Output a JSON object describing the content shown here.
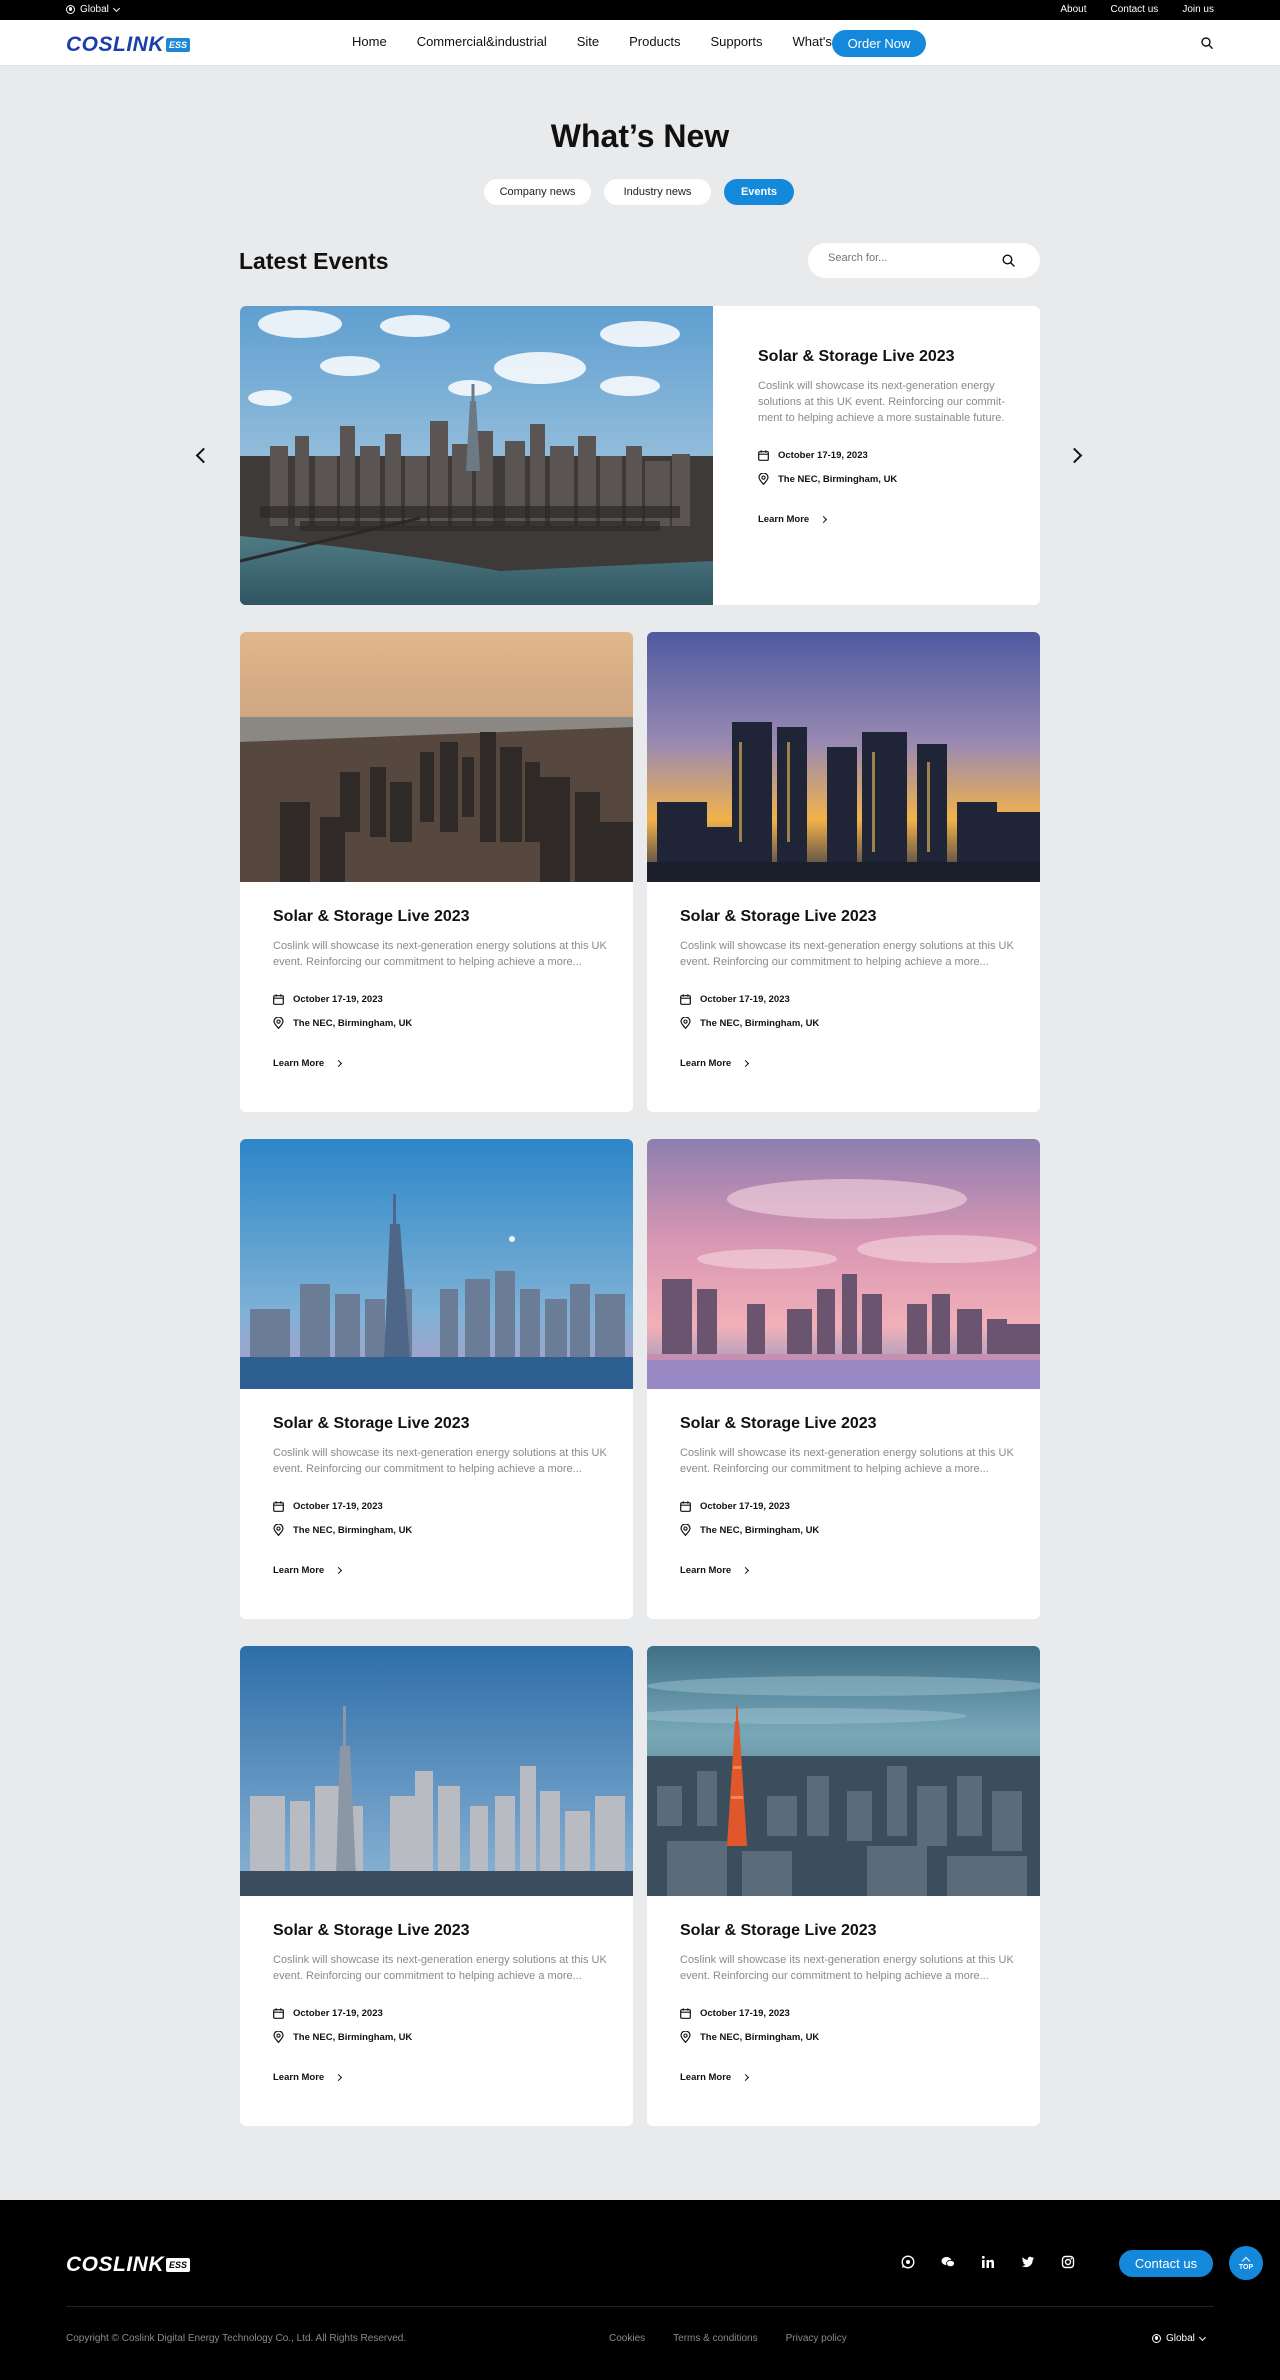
{
  "topbar": {
    "region": "Global",
    "links": [
      "About",
      "Contact us",
      "Join us"
    ]
  },
  "header": {
    "logo_text": "COSLINK",
    "logo_badge": "ESS",
    "nav": [
      "Home",
      "Commercial&industrial",
      "Site",
      "Products",
      "Supports",
      "What's new"
    ],
    "order_button": "Order Now",
    "search_icon": "search-icon"
  },
  "page": {
    "title": "What’s New",
    "tabs": [
      {
        "label": "Company news",
        "active": false
      },
      {
        "label": "Industry news",
        "active": false
      },
      {
        "label": "Events",
        "active": true
      }
    ],
    "section_title": "Latest Events",
    "search_placeholder": "Search for..."
  },
  "featured": {
    "title": "Solar & Storage Live 2023",
    "description": "Coslink will showcase its next-generation energy solutions at this UK event. Reinforcing our commit-ment to helping achieve a more sustainable future.",
    "date": "October 17-19, 2023",
    "location": "The NEC, Birmingham, UK",
    "link": "Learn More"
  },
  "events": [
    {
      "title": "Solar & Storage Live 2023",
      "description": "Coslink will showcase its next-generation energy solutions at this UK event. Reinforcing our commitment to helping achieve a more...",
      "date": "October 17-19, 2023",
      "location": "The NEC, Birmingham, UK",
      "link": "Learn More"
    },
    {
      "title": "Solar & Storage Live 2023",
      "description": "Coslink will showcase its next-generation energy solutions at this UK event. Reinforcing our commitment to helping achieve a more...",
      "date": "October 17-19, 2023",
      "location": "The NEC, Birmingham, UK",
      "link": "Learn More"
    },
    {
      "title": "Solar & Storage Live 2023",
      "description": "Coslink will showcase its next-generation energy solutions at this UK event. Reinforcing our commitment to helping achieve a more...",
      "date": "October 17-19, 2023",
      "location": "The NEC, Birmingham, UK",
      "link": "Learn More"
    },
    {
      "title": "Solar & Storage Live 2023",
      "description": "Coslink will showcase its next-generation energy solutions at this UK event. Reinforcing our commitment to helping achieve a more...",
      "date": "October 17-19, 2023",
      "location": "The NEC, Birmingham, UK",
      "link": "Learn More"
    },
    {
      "title": "Solar & Storage Live 2023",
      "description": "Coslink will showcase its next-generation energy solutions at this UK event. Reinforcing our commitment to helping achieve a more...",
      "date": "October 17-19, 2023",
      "location": "The NEC, Birmingham, UK",
      "link": "Learn More"
    },
    {
      "title": "Solar & Storage Live 2023",
      "description": "Coslink will showcase its next-generation energy solutions at this UK event. Reinforcing our commitment to helping achieve a more...",
      "date": "October 17-19, 2023",
      "location": "The NEC, Birmingham, UK",
      "link": "Learn More"
    }
  ],
  "footer": {
    "logo_text": "COSLINK",
    "logo_badge": "ESS",
    "socials": [
      "whatsapp-icon",
      "wechat-icon",
      "linkedin-icon",
      "twitter-icon",
      "instagram-icon"
    ],
    "contact_button": "Contact us",
    "top_button": "TOP",
    "copyright": "Copyright © Coslink Digital Energy Technology Co., Ltd. All Rights Reserved.",
    "legal": [
      "Cookies",
      "Terms & conditions",
      "Privacy policy"
    ],
    "region": "Global"
  },
  "colors": {
    "accent": "#1489dc",
    "brand": "#1b3fa8",
    "page_bg": "#e9eaec"
  }
}
